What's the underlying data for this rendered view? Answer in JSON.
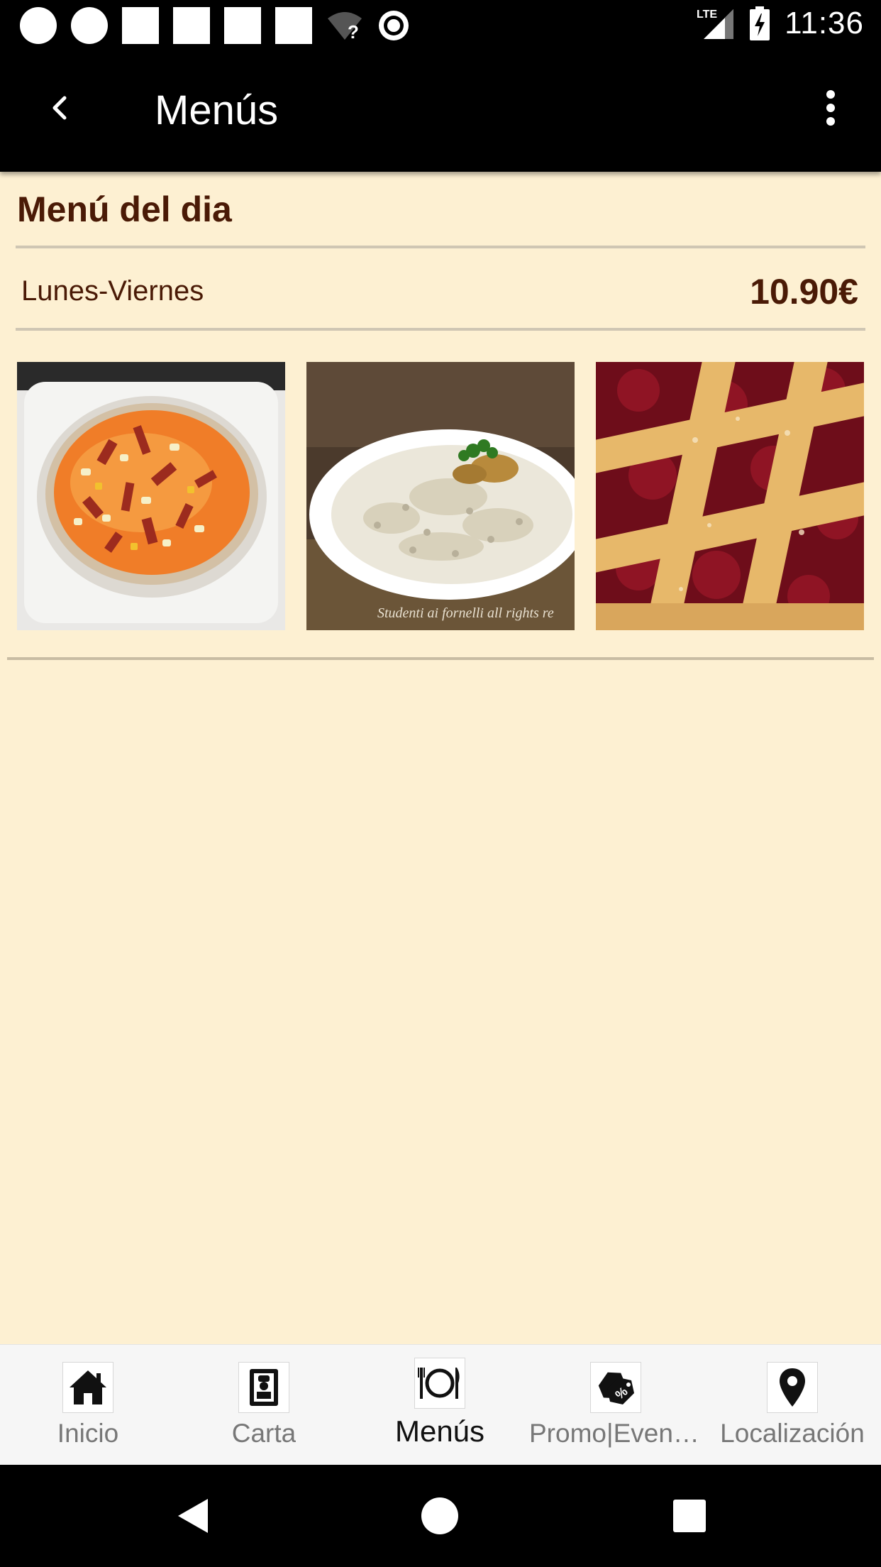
{
  "status_bar": {
    "time": "11:36",
    "network": "LTE"
  },
  "app_bar": {
    "title": "Menús"
  },
  "menu": {
    "title": "Menú del dia",
    "days": "Lunes-Viernes",
    "price": "10.90€",
    "photos": [
      {
        "icon": "gazpacho-photo",
        "caption": ""
      },
      {
        "icon": "risotto-photo",
        "caption": "Studenti ai fornelli all rights re"
      },
      {
        "icon": "cherry-pie-photo",
        "caption": ""
      }
    ]
  },
  "bottom_nav": {
    "items": [
      {
        "label": "Inicio",
        "icon": "home-icon"
      },
      {
        "label": "Carta",
        "icon": "chef-card-icon"
      },
      {
        "label": "Menús",
        "icon": "plate-cutlery-icon",
        "active": true
      },
      {
        "label": "Promo|Event…",
        "icon": "price-tag-icon"
      },
      {
        "label": "Localización",
        "icon": "map-pin-icon"
      }
    ]
  },
  "colors": {
    "background": "#fdf0d2",
    "title_brown": "#4a1a06",
    "app_bar": "#000000"
  }
}
